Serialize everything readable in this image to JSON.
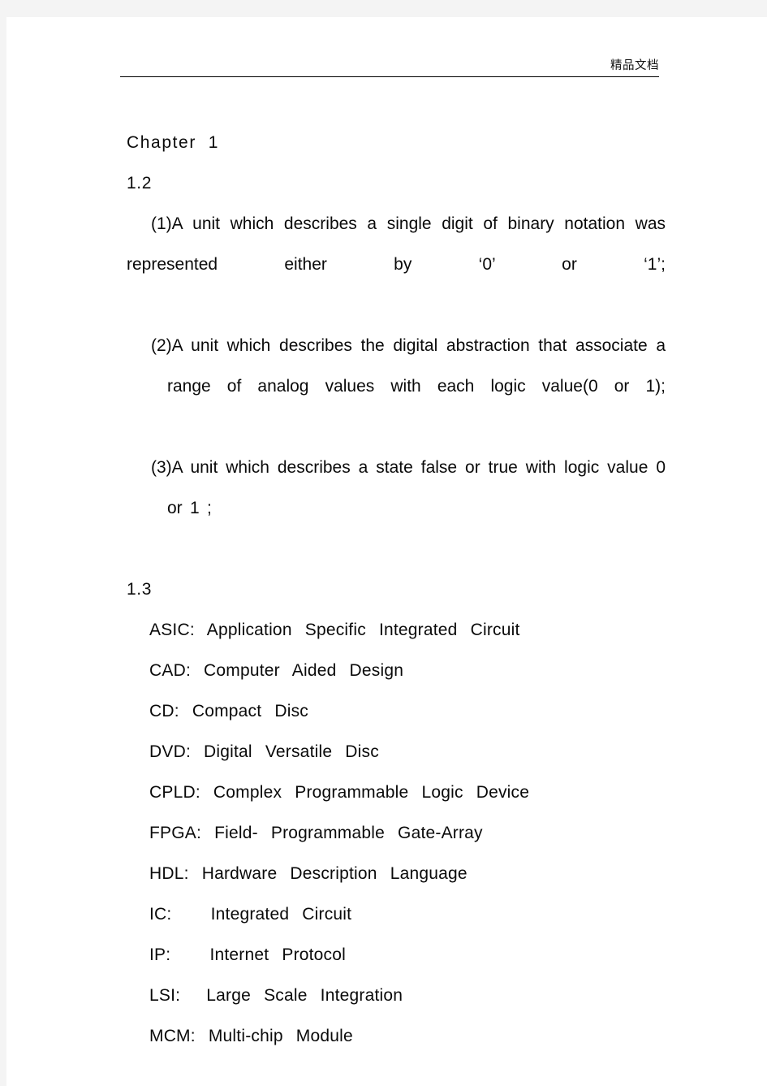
{
  "page": {
    "background_color": "#f4f4f4",
    "paper_color": "#ffffff"
  },
  "header": {
    "watermark_text": "精品文档",
    "rule": true,
    "color": "#111111"
  },
  "document": {
    "chapter_title": "Chapter  1",
    "sections": [
      {
        "number": "1.2",
        "items": [
          {
            "label": "(1)",
            "text": "(1)A unit which describes a single digit of binary notation was represented either by ‘0’ or ‘1’;"
          },
          {
            "label": "(2)",
            "text": "(2)A unit which describes the digital abstraction that associate a range of analog values with each logic value(0 or 1);"
          },
          {
            "label": "(3)",
            "text": "(3)A unit which describes a state false or true with logic value 0 or 1 ;"
          }
        ]
      },
      {
        "number": "1.3",
        "abbreviations": [
          {
            "abbr": "ASIC:",
            "expansion": "Application  Specific  Integrated  Circuit",
            "line": "ASIC:  Application  Specific  Integrated  Circuit"
          },
          {
            "abbr": "CAD:",
            "expansion": "Computer  Aided  Design",
            "line": "CAD:  Computer  Aided  Design"
          },
          {
            "abbr": "CD:",
            "expansion": "Compact  Disc",
            "line": "CD:  Compact  Disc"
          },
          {
            "abbr": "DVD:",
            "expansion": "Digital  Versatile  Disc",
            "line": "DVD:  Digital  Versatile  Disc"
          },
          {
            "abbr": "CPLD:",
            "expansion": "Complex  Programmable  Logic  Device",
            "line": "CPLD:  Complex  Programmable  Logic  Device"
          },
          {
            "abbr": "FPGA:",
            "expansion": "Field-  Programmable  Gate-Array",
            "line": "FPGA:  Field-  Programmable  Gate-Array"
          },
          {
            "abbr": "HDL:",
            "expansion": "Hardware  Description  Language",
            "line": "HDL:  Hardware  Description  Language"
          },
          {
            "abbr": "IC:",
            "expansion": "Integrated  Circuit",
            "line": "IC:      Integrated  Circuit"
          },
          {
            "abbr": "IP:",
            "expansion": "Internet  Protocol",
            "line": "IP:      Internet  Protocol"
          },
          {
            "abbr": "LSI:",
            "expansion": "Large  Scale  Integration",
            "line": "LSI:    Large  Scale  Integration"
          },
          {
            "abbr": "MCM:",
            "expansion": "Multi-chip  Module",
            "line": "MCM:  Multi-chip  Module"
          }
        ]
      }
    ]
  }
}
